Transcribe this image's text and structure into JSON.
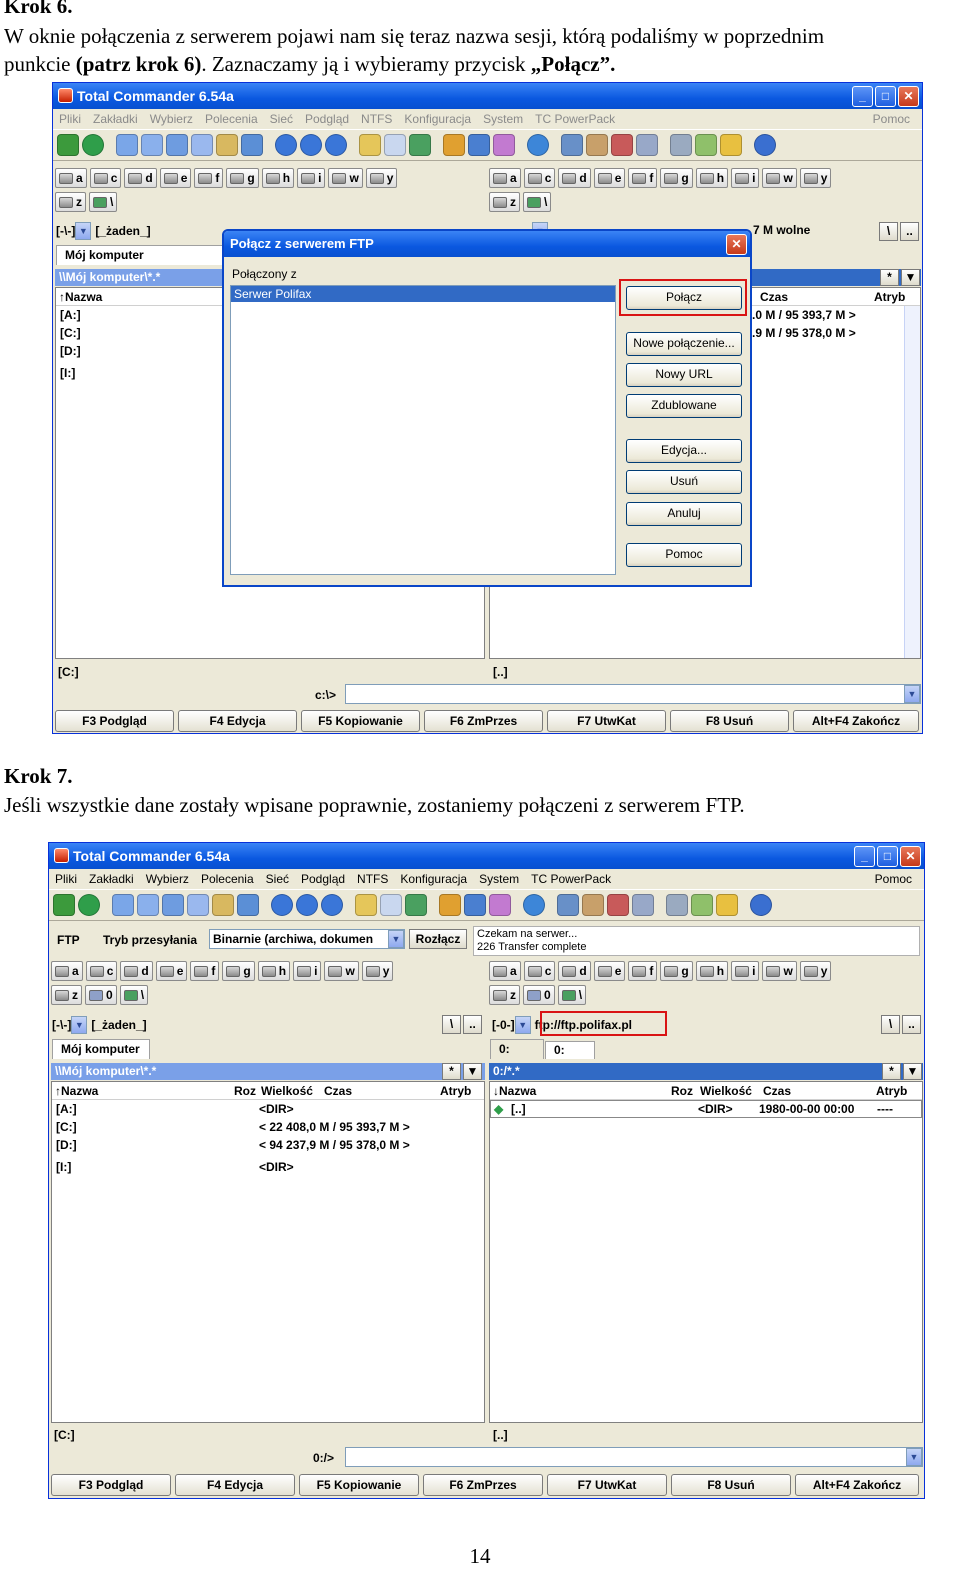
{
  "doc": {
    "step6_title": "Krok 6.",
    "step6_line1": "W oknie połączenia z serwerem pojawi nam się teraz nazwa sesji, którą podaliśmy w poprzednim",
    "step6_line2a": "punkcie ",
    "step6_line2b": "(patrz krok 6)",
    "step6_line2c": ". Zaznaczamy ją i wybieramy przycisk ",
    "step6_line2d": "„Połącz”.",
    "step7_title": "Krok 7.",
    "step7_line1": "Jeśli wszystkie dane zostały wpisane poprawnie, zostaniemy połączeni z serwerem FTP.",
    "page_number": "14"
  },
  "app": {
    "title": "Total Commander 6.54a",
    "menu": [
      "Pliki",
      "Zakładki",
      "Wybierz",
      "Polecenia",
      "Sieć",
      "Podgląd",
      "NTFS",
      "Konfiguracja",
      "System",
      "TC PowerPack"
    ],
    "menu_right": "Pomoc",
    "drives": [
      "a",
      "c",
      "d",
      "e",
      "f",
      "g",
      "h",
      "i",
      "w",
      "y"
    ],
    "drives_row2": [
      "z",
      "\\"
    ],
    "drives_row2_ftp": [
      "z",
      "0",
      "\\"
    ],
    "fkeys": [
      "F3 Podgląd",
      "F4 Edycja",
      "F5 Kopiowanie",
      "F6 ZmPrzes",
      "F7 UtwKat",
      "F8 Usuń",
      "Alt+F4 Zakończ"
    ]
  },
  "shot1": {
    "left_drive_combo": "[-\\-]",
    "left_drive_label": "[_żaden_]",
    "left_tab": "Mój komputer",
    "left_path": "\\\\Mój komputer\\*.*",
    "left_col_name": "↑Nazwa",
    "left_items": [
      "[A:]",
      "[C:]",
      "[D:]",
      "[I:]"
    ],
    "right_free": "7 M wolne",
    "right_col_time": "Czas",
    "right_col_attr": "Atryb",
    "right_sizes": [
      ".0 M / 95 393,7 M >",
      ".9 M / 95 378,0 M >"
    ],
    "left_status": "[C:]",
    "right_status": "[..]",
    "cmd_prompt": "c:\\>",
    "dialog": {
      "title": "Połącz z serwerem FTP",
      "list_label": "Połączony z",
      "list_items": [
        "Serwer Polifax"
      ],
      "buttons": [
        "Połącz",
        "Nowe połączenie...",
        "Nowy URL",
        "Zdublowane",
        "Edycja...",
        "Usuń",
        "Anuluj",
        "Pomoc"
      ]
    }
  },
  "shot2": {
    "ftp_label": "FTP",
    "transfer_mode_label": "Tryb przesyłania",
    "transfer_mode_value": "Binarnie (archiwa, dokumen",
    "disconnect": "Rozłącz",
    "log_lines": [
      "Czekam na serwer...",
      "226 Transfer complete"
    ],
    "left_drive_combo": "[-\\-]",
    "left_drive_label": "[_żaden_]",
    "right_drive_combo": "[-0-]",
    "right_url": "ftp://ftp.polifax.pl",
    "left_tab": "Mój komputer",
    "right_tabs": [
      "0:",
      "0:"
    ],
    "left_path": "\\\\Mój komputer\\*.*",
    "right_path": "0:/*.*",
    "columns_left": [
      "↑Nazwa",
      "Roz",
      "Wielkość",
      "Czas",
      "Atryb"
    ],
    "columns_right": [
      "↓Nazwa",
      "Roz",
      "Wielkość",
      "Czas",
      "Atryb"
    ],
    "left_rows": [
      {
        "name": "[A:]",
        "size": "<DIR>"
      },
      {
        "name": "[C:]",
        "size": "< 22 408,0 M / 95 393,7 M >"
      },
      {
        "name": "[D:]",
        "size": "< 94 237,9 M / 95 378,0 M >"
      },
      {
        "name": "[I:]",
        "size": "<DIR>"
      }
    ],
    "right_rows": [
      {
        "name": "[..]",
        "size": "<DIR>",
        "time": "1980-00-00 00:00",
        "attr": "----"
      }
    ],
    "left_status": "[C:]",
    "right_status": "[..]",
    "cmd_prompt": "0:/>"
  },
  "colors": {
    "selection": "#316ac5",
    "xp_blue": "#0a58e0",
    "highlight_box": "#d91414",
    "path_bar": "#7aa0e8"
  }
}
